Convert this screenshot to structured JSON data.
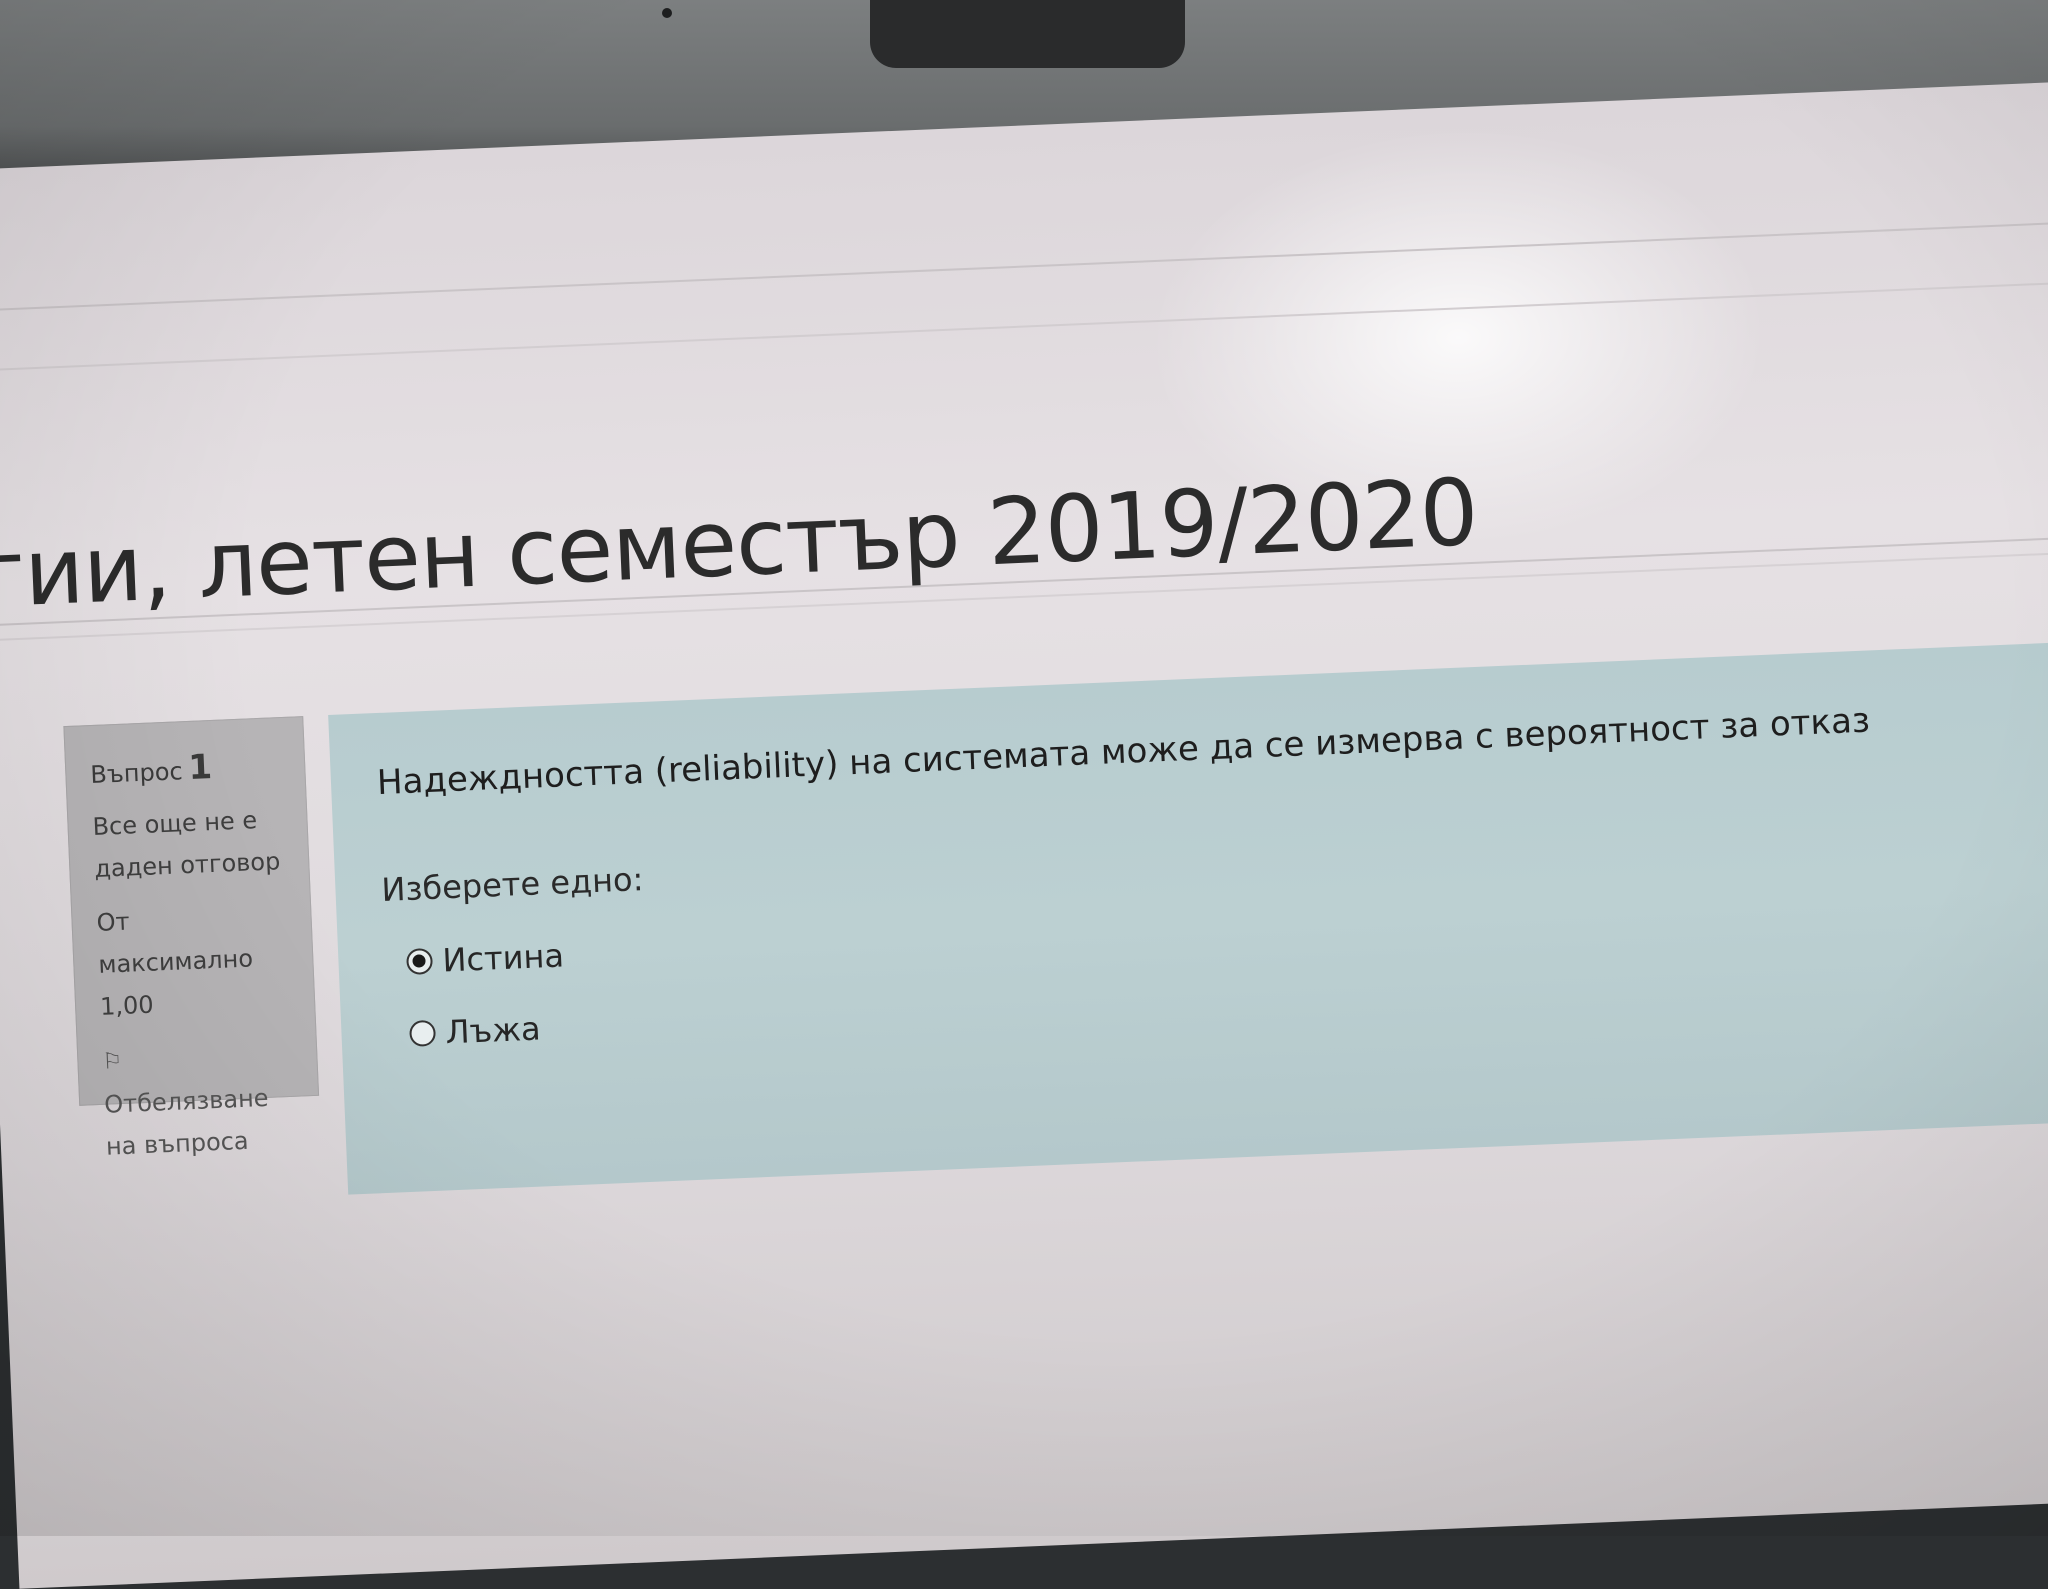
{
  "header": {
    "course_title": "гии, летен семестър 2019/2020"
  },
  "question_info": {
    "label": "Въпрос",
    "number": "1",
    "state_line1": "Все още не е",
    "state_line2": "даден отговор",
    "mark_line1": "От максимално",
    "mark_line2": "1,00",
    "flag_line1": "Отбелязване",
    "flag_line2": "на въпроса",
    "flag_icon": "flag-icon"
  },
  "question": {
    "text": "Надеждността (reliability) на системата може да се измерва с вероятност за отказ",
    "prompt": "Изберете едно:",
    "answers": [
      {
        "label": "Истина",
        "selected": true
      },
      {
        "label": "Лъжа",
        "selected": false
      }
    ]
  },
  "colors": {
    "content_bg": "#b7cccf",
    "info_bg": "#b6b4b6",
    "page_bg": "#e6e1e4"
  }
}
